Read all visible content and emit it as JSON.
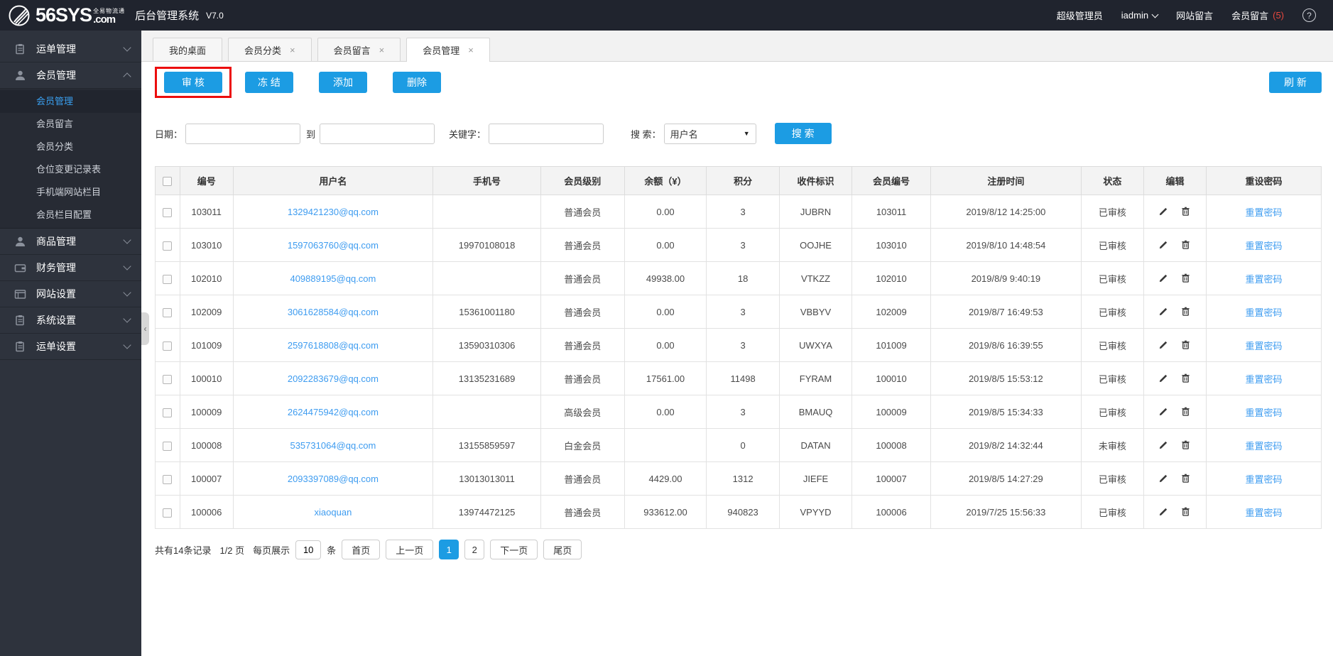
{
  "colors": {
    "accent_blue": "#1c9ce3",
    "link_blue": "#3e9cf0",
    "annotation_red": "#ec0d0d",
    "badge_red": "#e8483e",
    "sidebar_active_blue": "#3aa0f0"
  },
  "header": {
    "brand": "56SYS",
    "brand_dotcom": ".com",
    "brand_tagline": "全易物流通",
    "title": "后台管理系统",
    "version": "V7.0",
    "role": "超级管理员",
    "username": "iadmin",
    "site_messages": "网站留言",
    "member_messages": "会员留言",
    "member_messages_count": "(5)",
    "help": "?"
  },
  "sidebar": {
    "menu": [
      {
        "label": "运单管理",
        "icon": "waybill-icon",
        "state": "collapsed"
      },
      {
        "label": "会员管理",
        "icon": "member-icon",
        "state": "expanded",
        "children": [
          "会员管理",
          "会员留言",
          "会员分类",
          "仓位变更记录表",
          "手机端网站栏目",
          "会员栏目配置"
        ],
        "active_child": "会员管理"
      },
      {
        "label": "商品管理",
        "icon": "goods-icon",
        "state": "collapsed"
      },
      {
        "label": "财务管理",
        "icon": "finance-icon",
        "state": "collapsed"
      },
      {
        "label": "网站设置",
        "icon": "website-icon",
        "state": "collapsed"
      },
      {
        "label": "系统设置",
        "icon": "system-icon",
        "state": "collapsed"
      },
      {
        "label": "运单设置",
        "icon": "waybill-settings-icon",
        "state": "collapsed"
      }
    ]
  },
  "tabs": [
    {
      "label": "我的桌面",
      "closable": false,
      "active": false
    },
    {
      "label": "会员分类",
      "closable": true,
      "active": false
    },
    {
      "label": "会员留言",
      "closable": true,
      "active": false
    },
    {
      "label": "会员管理",
      "closable": true,
      "active": true
    }
  ],
  "toolbar": {
    "audit": "审 核",
    "freeze": "冻 结",
    "add": "添加",
    "delete": "删除",
    "refresh": "刷 新"
  },
  "filters": {
    "date_label": "日期：",
    "to_label": "到",
    "keyword_label": "关键字：",
    "search_label": "搜 索：",
    "search_type_selected": "用户名",
    "search_button": "搜 索"
  },
  "table": {
    "headers": [
      "编号",
      "用户名",
      "手机号",
      "会员级别",
      "余额（¥）",
      "积分",
      "收件标识",
      "会员编号",
      "注册时间",
      "状态",
      "编辑",
      "重设密码"
    ],
    "reset_link_label": "重置密码",
    "rows": [
      {
        "id": "103011",
        "username": "1329421230@qq.com",
        "phone": "",
        "level": "普通会员",
        "balance": "0.00",
        "points": "3",
        "recv": "JUBRN",
        "member_no": "103011",
        "reg_time": "2019/8/12 14:25:00",
        "status": "已审核"
      },
      {
        "id": "103010",
        "username": "1597063760@qq.com",
        "phone": "19970108018",
        "level": "普通会员",
        "balance": "0.00",
        "points": "3",
        "recv": "OOJHE",
        "member_no": "103010",
        "reg_time": "2019/8/10 14:48:54",
        "status": "已审核"
      },
      {
        "id": "102010",
        "username": "409889195@qq.com",
        "phone": "",
        "level": "普通会员",
        "balance": "49938.00",
        "points": "18",
        "recv": "VTKZZ",
        "member_no": "102010",
        "reg_time": "2019/8/9 9:40:19",
        "status": "已审核"
      },
      {
        "id": "102009",
        "username": "3061628584@qq.com",
        "phone": "15361001180",
        "level": "普通会员",
        "balance": "0.00",
        "points": "3",
        "recv": "VBBYV",
        "member_no": "102009",
        "reg_time": "2019/8/7 16:49:53",
        "status": "已审核"
      },
      {
        "id": "101009",
        "username": "2597618808@qq.com",
        "phone": "13590310306",
        "level": "普通会员",
        "balance": "0.00",
        "points": "3",
        "recv": "UWXYA",
        "member_no": "101009",
        "reg_time": "2019/8/6 16:39:55",
        "status": "已审核"
      },
      {
        "id": "100010",
        "username": "2092283679@qq.com",
        "phone": "13135231689",
        "level": "普通会员",
        "balance": "17561.00",
        "points": "11498",
        "recv": "FYRAM",
        "member_no": "100010",
        "reg_time": "2019/8/5 15:53:12",
        "status": "已审核"
      },
      {
        "id": "100009",
        "username": "2624475942@qq.com",
        "phone": "",
        "level": "高级会员",
        "balance": "0.00",
        "points": "3",
        "recv": "BMAUQ",
        "member_no": "100009",
        "reg_time": "2019/8/5 15:34:33",
        "status": "已审核"
      },
      {
        "id": "100008",
        "username": "535731064@qq.com",
        "phone": "13155859597",
        "level": "白金会员",
        "balance": "",
        "points": "0",
        "recv": "DATAN",
        "member_no": "100008",
        "reg_time": "2019/8/2 14:32:44",
        "status": "未审核"
      },
      {
        "id": "100007",
        "username": "2093397089@qq.com",
        "phone": "13013013011",
        "level": "普通会员",
        "balance": "4429.00",
        "points": "1312",
        "recv": "JIEFE",
        "member_no": "100007",
        "reg_time": "2019/8/5 14:27:29",
        "status": "已审核"
      },
      {
        "id": "100006",
        "username": "xiaoquan",
        "phone": "13974472125",
        "level": "普通会员",
        "balance": "933612.00",
        "points": "940823",
        "recv": "VPYYD",
        "member_no": "100006",
        "reg_time": "2019/7/25 15:56:33",
        "status": "已审核"
      }
    ]
  },
  "pagination": {
    "total_text": "共有14条记录",
    "page_info": "1/2 页",
    "per_page_prefix": "每页展示",
    "per_page_value": "10",
    "per_page_suffix": "条",
    "first": "首页",
    "prev": "上一页",
    "pages": [
      "1",
      "2"
    ],
    "active_page": "1",
    "next": "下一页",
    "last": "尾页"
  }
}
